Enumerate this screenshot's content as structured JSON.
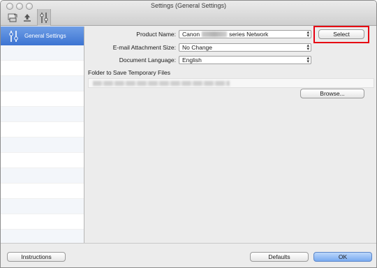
{
  "window": {
    "title": "Settings (General Settings)"
  },
  "toolbar": {
    "icons": [
      "scanner-icon",
      "upload-icon",
      "settings-icon"
    ]
  },
  "sidebar": {
    "items": [
      {
        "label": "General Settings",
        "selected": true
      }
    ]
  },
  "form": {
    "product_name_label": "Product Name:",
    "product_name_value_prefix": "Canon",
    "product_name_value_suffix": "series Network",
    "select_button": "Select",
    "email_label": "E-mail Attachment Size:",
    "email_value": "No Change",
    "language_label": "Document Language:",
    "language_value": "English",
    "folder_label": "Folder to Save Temporary Files",
    "browse_button": "Browse..."
  },
  "footer": {
    "instructions": "Instructions",
    "defaults": "Defaults",
    "ok": "OK"
  },
  "colors": {
    "highlight": "#e60012",
    "selection": "#3c74d2",
    "default_button": "#79aaf0"
  }
}
